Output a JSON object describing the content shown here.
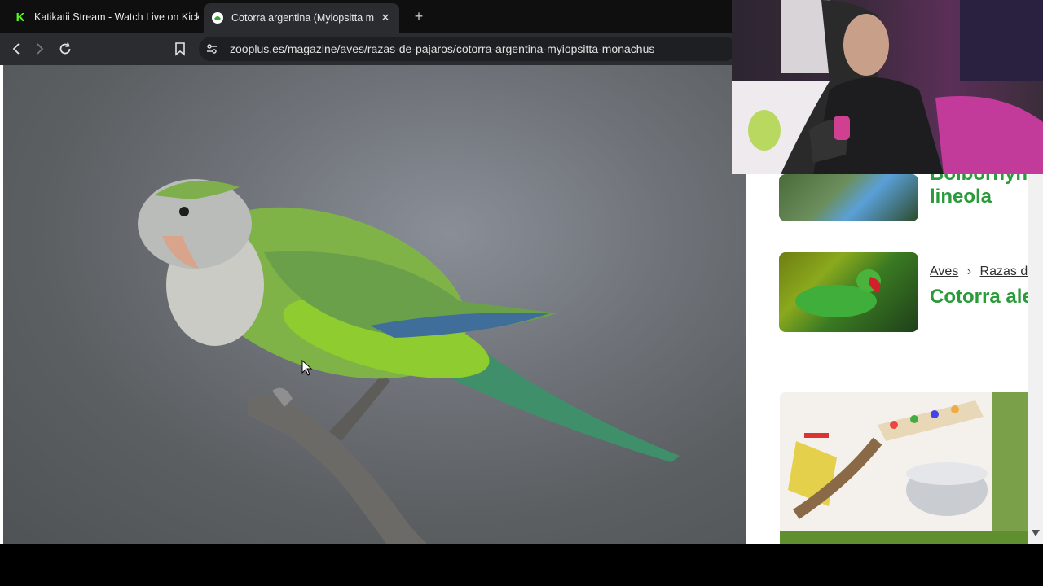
{
  "browser": {
    "tabs": [
      {
        "title": "Katikatii Stream - Watch Live on Kick",
        "favicon": "kick-logo-icon",
        "active": false
      },
      {
        "title": "Cotorra argentina (Myiopsitta m",
        "favicon": "zooplus-logo-icon",
        "active": true
      }
    ],
    "new_tab_icon": "plus-icon",
    "url": "zooplus.es/magazine/aves/razas-de-pajaros/cotorra-argentina-myiopsitta-monachus"
  },
  "sidebar": {
    "cards": [
      {
        "title_lines": [
          "Bolborhync",
          "lineola"
        ],
        "thumb": "blue-parakeet-photo"
      },
      {
        "breadcrumb": [
          "Aves",
          "Razas de"
        ],
        "title": "Cotorra ale",
        "thumb": "green-parrot-photo"
      }
    ],
    "ad": {
      "image": "bird-toys-ladder-photo"
    }
  },
  "colors": {
    "accent_green": "#2b9a3b",
    "kick_green": "#53fc18"
  }
}
